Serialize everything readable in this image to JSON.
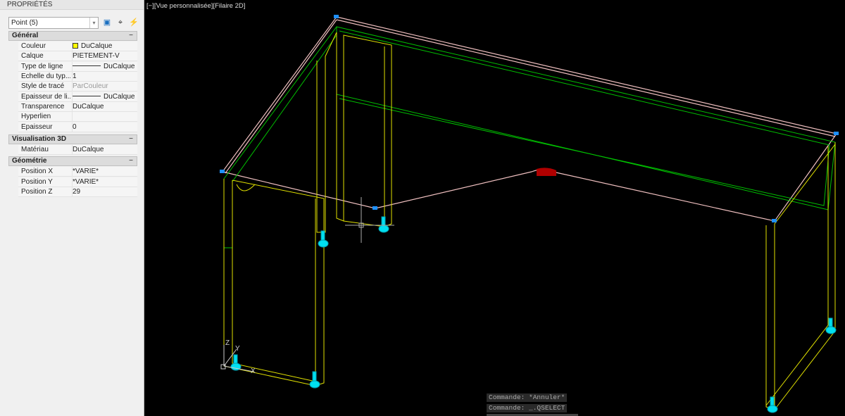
{
  "panel": {
    "title": "PROPRIÉTÉS",
    "selection": "Point (5)",
    "sections": {
      "general": {
        "title": "Général",
        "collapse": "−",
        "rows": [
          {
            "k": "Couleur",
            "v": "DuCalque"
          },
          {
            "k": "Calque",
            "v": "PIETEMENT-V"
          },
          {
            "k": "Type de ligne",
            "v": "DuCalque"
          },
          {
            "k": "Echelle du typ...",
            "v": "1"
          },
          {
            "k": "Style de tracé",
            "v": "ParCouleur"
          },
          {
            "k": "Epaisseur de li...",
            "v": "DuCalque"
          },
          {
            "k": "Transparence",
            "v": "DuCalque"
          },
          {
            "k": "Hyperlien",
            "v": ""
          },
          {
            "k": "Epaisseur",
            "v": "0"
          }
        ]
      },
      "vis3d": {
        "title": "Visualisation 3D",
        "collapse": "−",
        "rows": [
          {
            "k": "Matériau",
            "v": "DuCalque"
          }
        ]
      },
      "geom": {
        "title": "Géométrie",
        "collapse": "−",
        "rows": [
          {
            "k": "Position X",
            "v": "*VARIE*"
          },
          {
            "k": "Position Y",
            "v": "*VARIE*"
          },
          {
            "k": "Position Z",
            "v": "29"
          }
        ]
      }
    }
  },
  "viewport": {
    "label": "[−][Vue personnalisée][Filaire 2D]",
    "ucs": {
      "x": "X",
      "y": "Y",
      "z": "Z"
    },
    "commands": [
      "Commande: *Annuler*",
      "Commande: _.QSELECT"
    ]
  },
  "colors": {
    "outline": "#f0c0c0",
    "frame": "#00c000",
    "legs": "#e0e000",
    "feet": "#00e0f0",
    "grip": "#1e90ff"
  }
}
